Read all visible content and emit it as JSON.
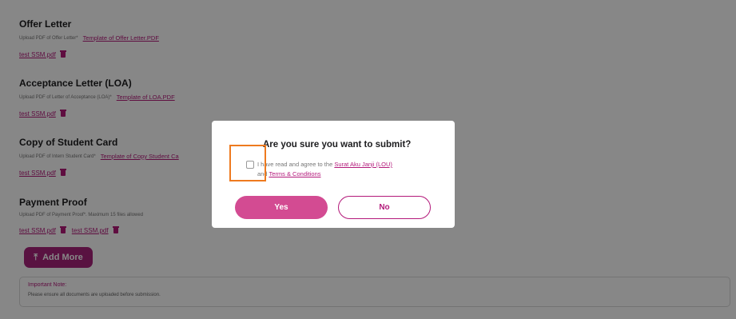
{
  "sections": [
    {
      "title": "Offer Letter",
      "subtitle": "Upload PDF of Offer Letter*",
      "template_link": "Template of Offer Letter.PDF",
      "files": [
        "test SSM.pdf"
      ]
    },
    {
      "title": "Acceptance Letter (LOA)",
      "subtitle": "Upload PDF of Letter of Acceptance (LOA)*",
      "template_link": "Template of LOA.PDF",
      "files": [
        "test SSM.pdf"
      ]
    },
    {
      "title": "Copy of Student Card",
      "subtitle": "Upload PDF of Intern Student Card*",
      "template_link": "Template of Copy Student Ca",
      "files": [
        "test SSM.pdf"
      ]
    },
    {
      "title": "Payment Proof",
      "subtitle": "Upload PDF of Payment Proof*. Maximum 15 files allowed",
      "template_link": "",
      "files": [
        "test SSM.pdf",
        "test SSM.pdf"
      ]
    }
  ],
  "add_more": {
    "icon": "upload-icon",
    "label": "Add More"
  },
  "note": {
    "title": "Important Note:",
    "body": "Please ensure all documents are uploaded before submission."
  },
  "modal": {
    "title": "Are you sure you want to submit?",
    "agree_text_1": "I have read and agree to the",
    "lou_link": "Surat Aku Janji (LOU)",
    "agree_text_2": "and",
    "terms_link": "Terms & Conditions",
    "checkbox_checked": false,
    "yes_label": "Yes",
    "no_label": "No"
  },
  "colors": {
    "accent": "#b3197a",
    "yes_button": "#d34b92",
    "highlight": "#ee7a1f"
  }
}
